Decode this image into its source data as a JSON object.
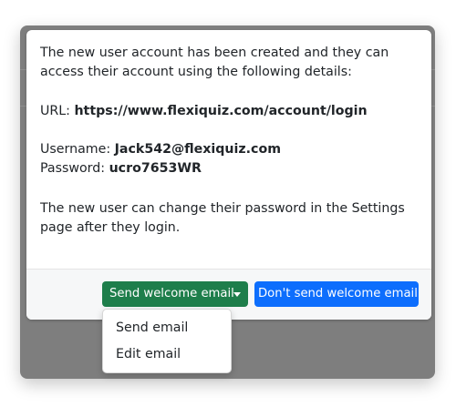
{
  "modal": {
    "intro": "The new user account has been created and they can access their account using the following details:",
    "url_label": "URL:",
    "url_value": "https://www.flexiquiz.com/account/login",
    "username_label": "Username:",
    "username_value": "Jack542@flexiquiz.com",
    "password_label": "Password:",
    "password_value": "ucro7653WR",
    "note": "The new user can change their password in the Settings page after they login."
  },
  "footer": {
    "send_welcome_label": "Send welcome email",
    "dont_send_label": "Don't send welcome email"
  },
  "dropdown": {
    "items": [
      {
        "label": "Send email"
      },
      {
        "label": "Edit email"
      }
    ]
  },
  "colors": {
    "green_button": "#1e7e4b",
    "blue_button": "#0d6efd",
    "backdrop": "#7e7e7e"
  },
  "icons": {
    "dropdown_toggle": "caret-down-icon"
  }
}
